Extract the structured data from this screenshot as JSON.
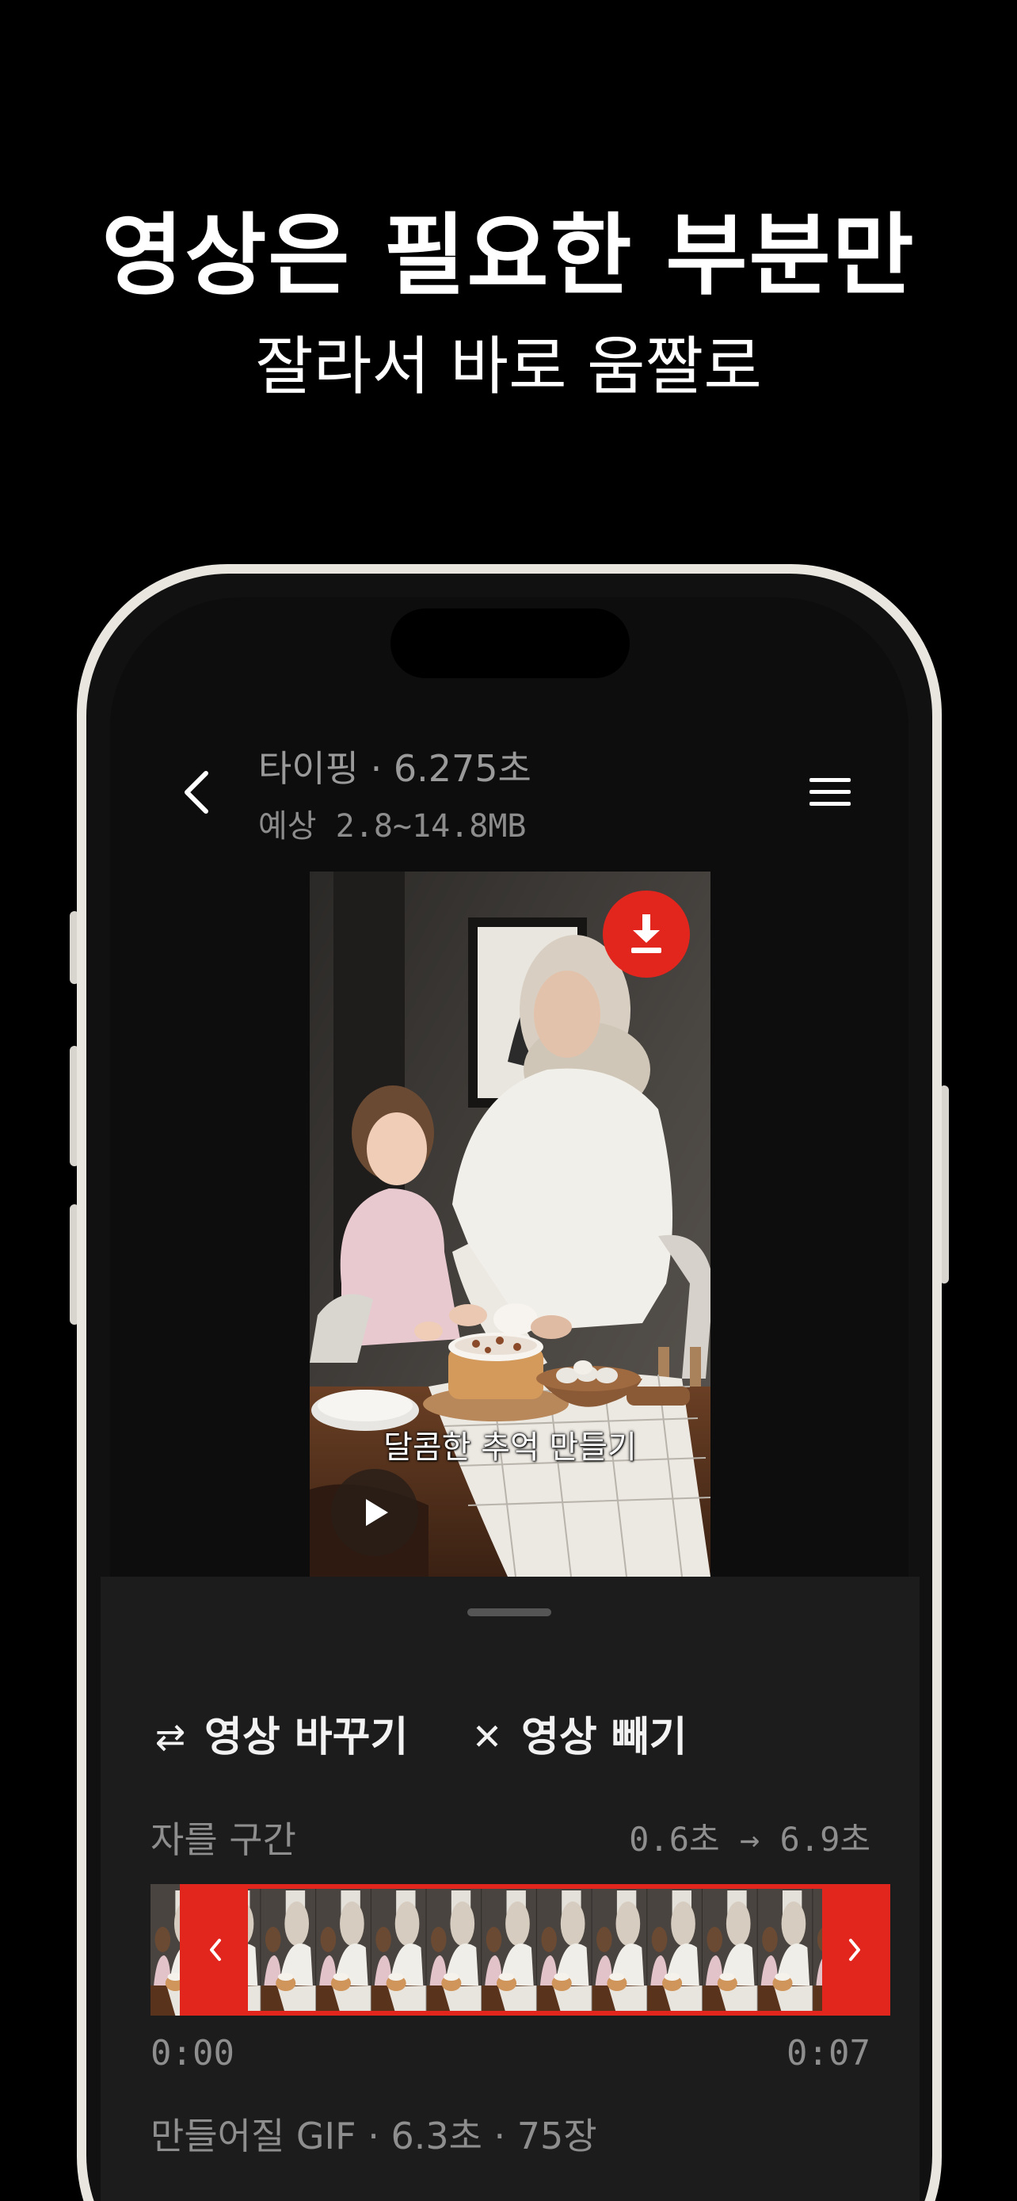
{
  "promo": {
    "headline": "영상은 필요한 부분만",
    "subline": "잘라서 바로 움짤로"
  },
  "header": {
    "title": "타이핑 · 6.275초",
    "subtitle": "예상 2.8~14.8MB"
  },
  "video": {
    "caption": "달콤한 추억 만들기"
  },
  "actions": {
    "swap_label": "영상 바꾸기",
    "remove_label": "영상 빼기"
  },
  "trim": {
    "label": "자를 구간",
    "range": "0.6초 → 6.9초",
    "start_time": "0:00",
    "end_time": "0:07",
    "selection_start": 0.6,
    "selection_end": 6.9,
    "duration": 7
  },
  "gif": {
    "summary": "만들어질 GIF · 6.3초 · 75장"
  },
  "colors": {
    "accent": "#e3261d",
    "background": "#000000",
    "sheet": "#1c1c1c",
    "muted_text": "#8e8e8e"
  },
  "icons": {
    "back": "chevron-left-icon",
    "menu": "hamburger-menu-icon",
    "download": "download-icon",
    "play": "play-icon",
    "swap": "swap-arrows-icon",
    "remove": "close-x-icon",
    "handle_left": "chevron-left-icon",
    "handle_right": "chevron-right-icon"
  }
}
